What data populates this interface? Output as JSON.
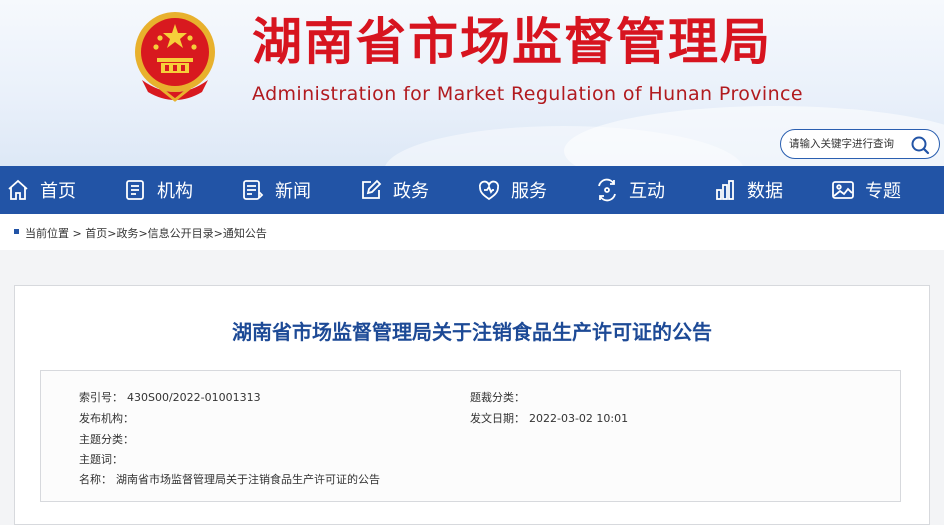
{
  "header": {
    "title": "湖南省市场监督管理局",
    "subtitle": "Administration for Market Regulation of Hunan Province",
    "search_placeholder": "请输入关键字进行查询",
    "title_color": "#d7141f"
  },
  "nav": {
    "background": "#2254a6",
    "items": [
      {
        "label": "首页",
        "icon": "home-icon"
      },
      {
        "label": "机构",
        "icon": "org-icon"
      },
      {
        "label": "新闻",
        "icon": "news-icon"
      },
      {
        "label": "政务",
        "icon": "edit-icon"
      },
      {
        "label": "服务",
        "icon": "service-icon"
      },
      {
        "label": "互动",
        "icon": "interact-icon"
      },
      {
        "label": "数据",
        "icon": "chart-icon"
      },
      {
        "label": "专题",
        "icon": "image-icon"
      }
    ]
  },
  "breadcrumb": {
    "prefix": "当前位置 >",
    "items": [
      "首页",
      "政务",
      "信息公开目录",
      "通知公告"
    ],
    "separator": ">"
  },
  "article": {
    "title": "湖南省市场监督管理局关于注销食品生产许可证的公告",
    "meta": {
      "index_label": "索引号：",
      "index_value": "430S00/2022-01001313",
      "category_label": "题裁分类：",
      "category_value": "",
      "publisher_label": "发布机构：",
      "publisher_value": "",
      "date_label": "发文日期：",
      "date_value": "2022-03-02 10:01",
      "topic_label": "主题分类：",
      "topic_value": "",
      "keywords_label": "主题词：",
      "keywords_value": "",
      "name_label": "名称：",
      "name_value": "湖南省市场监督管理局关于注销食品生产许可证的公告"
    }
  }
}
